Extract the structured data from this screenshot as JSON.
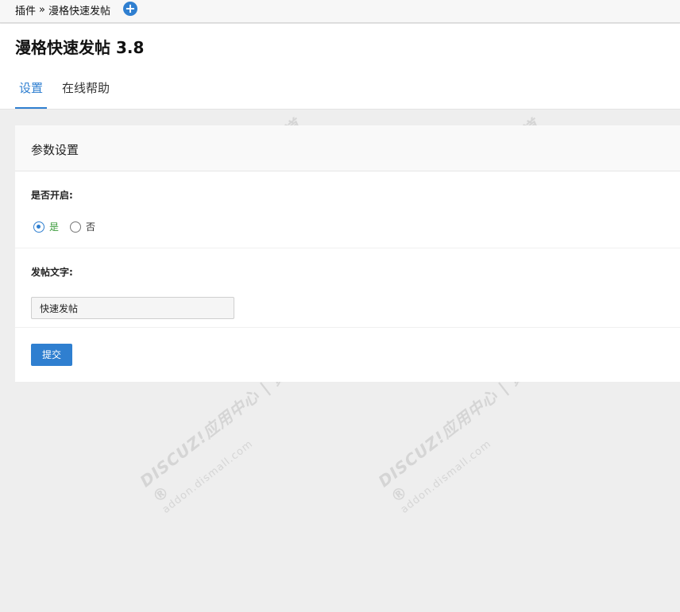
{
  "breadcrumb": {
    "root": "插件",
    "separator": "»",
    "current": "漫格快速发帖"
  },
  "page": {
    "title": "漫格快速发帖 3.8"
  },
  "tabs": [
    {
      "label": "设置",
      "active": true
    },
    {
      "label": "在线帮助",
      "active": false
    }
  ],
  "panel": {
    "header": "参数设置",
    "enable_field": {
      "label": "是否开启:",
      "options": [
        "是",
        "否"
      ],
      "selected": "是"
    },
    "text_field": {
      "label": "发帖文字:",
      "value": "快速发帖"
    },
    "submit_label": "提交"
  },
  "watermark": {
    "line1": "DISCUZ!应用中心 | 贰道®",
    "line2": "addon.dismall.com"
  },
  "colors": {
    "accent": "#2f7fd0",
    "yes": "#3a9a3a"
  },
  "icons": {
    "add": "plus-circle-icon",
    "radio_checked": "radio-checked-icon",
    "radio_unchecked": "radio-unchecked-icon"
  }
}
